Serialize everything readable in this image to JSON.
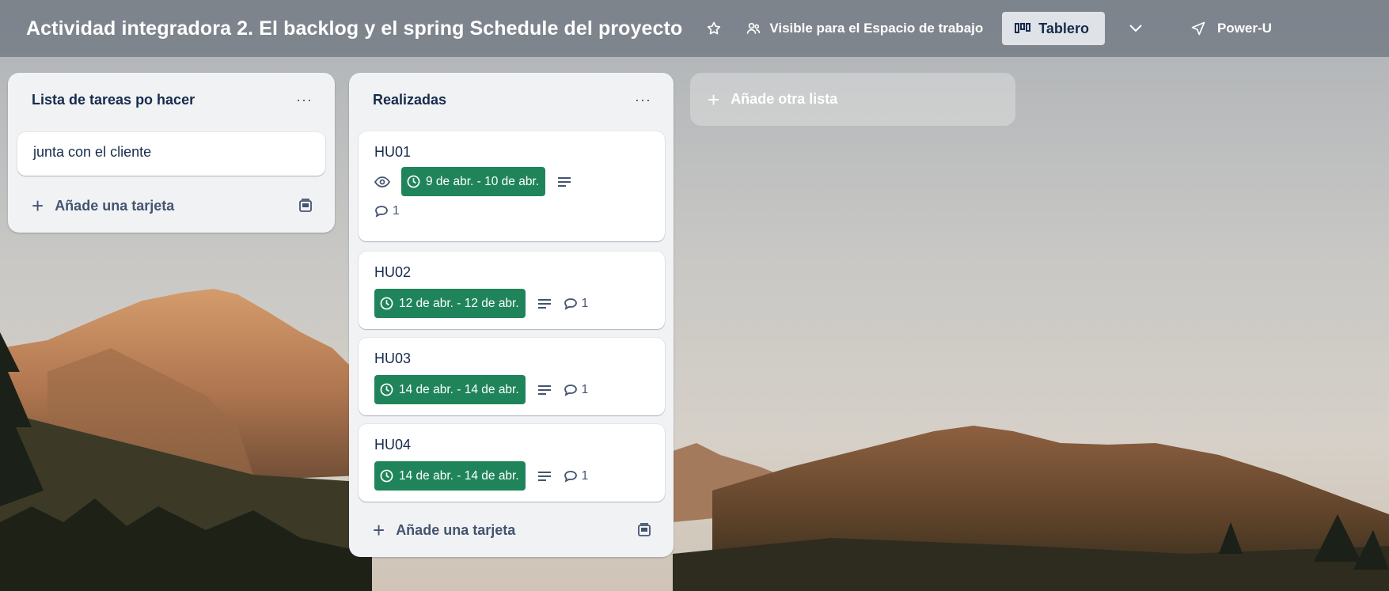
{
  "board": {
    "title": "Actividad integradora 2. El backlog y el spring Schedule del proyecto",
    "visibility_label": "Visible para el Espacio de trabajo",
    "view_label": "Tablero",
    "power_ups_label": "Power-U"
  },
  "lists": [
    {
      "title": "Lista de tareas po hacer",
      "menu": "···",
      "cards": [
        {
          "title": "junta con el cliente"
        }
      ],
      "add_card_label": "Añade una tarjeta"
    },
    {
      "title": "Realizadas",
      "menu": "···",
      "cards": [
        {
          "title": "HU01",
          "date": "9 de abr. - 10 de abr.",
          "comments": "1",
          "watching": true
        },
        {
          "title": "HU02",
          "date": "12 de abr. - 12 de abr.",
          "comments": "1"
        },
        {
          "title": "HU03",
          "date": "14 de abr. - 14 de abr.",
          "comments": "1"
        },
        {
          "title": "HU04",
          "date": "14 de abr. - 14 de abr.",
          "comments": "1"
        }
      ],
      "add_card_label": "Añade una tarjeta"
    }
  ],
  "add_list_label": "Añade otra lista",
  "colors": {
    "date_badge": "#1f845a",
    "list_bg": "#f1f2f4",
    "text": "#172b4d"
  },
  "icons": [
    "star-icon",
    "visibility-icon",
    "board-icon",
    "chevron-down-icon",
    "power-ups-icon",
    "eye-icon",
    "clock-icon",
    "description-icon",
    "comment-icon",
    "template-icon",
    "plus-icon"
  ]
}
